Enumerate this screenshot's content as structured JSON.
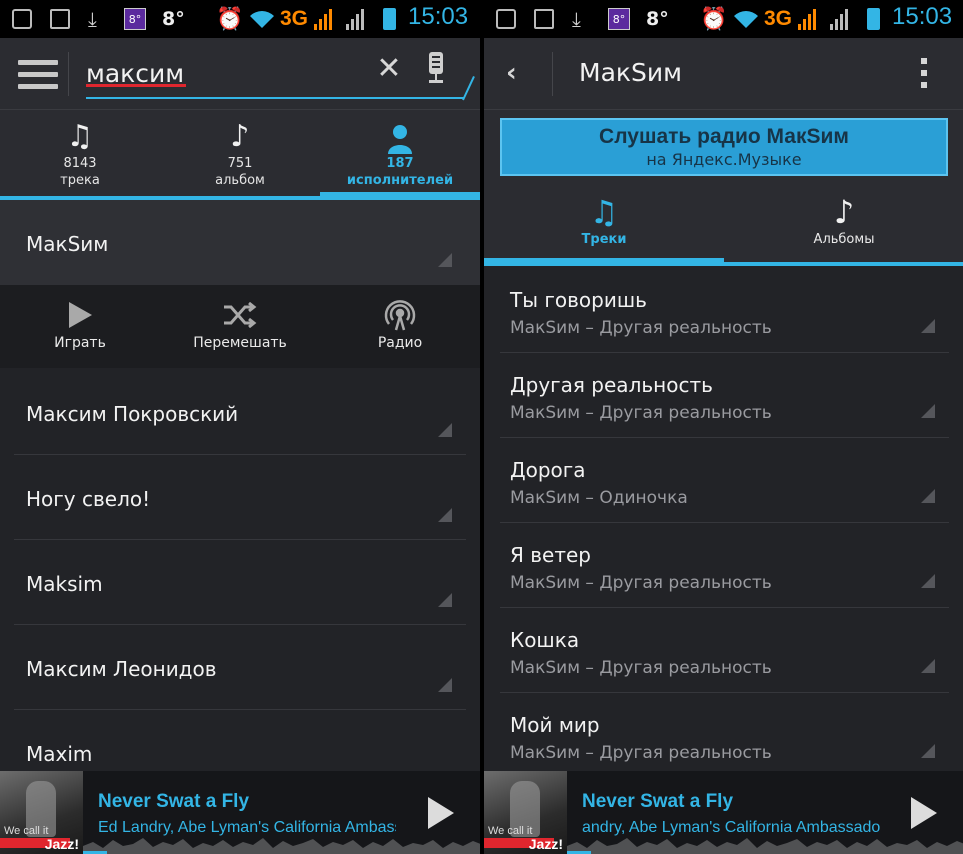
{
  "status_bar": {
    "temperature": "8°",
    "weather_badge": "8°",
    "network": "3G",
    "time": "15:03"
  },
  "left": {
    "search": {
      "value": "максим"
    },
    "tabs": [
      {
        "icon": "music-notes-icon",
        "count": "8143",
        "label": "трека"
      },
      {
        "icon": "music-note-icon",
        "count": "751",
        "label": "альбом"
      },
      {
        "icon": "person-icon",
        "count": "187",
        "label": "исполнителей",
        "active": true
      }
    ],
    "expanded_artist": "МакSим",
    "actions": [
      {
        "icon": "play-icon",
        "label": "Играть"
      },
      {
        "icon": "shuffle-icon",
        "label": "Перемешать"
      },
      {
        "icon": "radio-icon",
        "label": "Радио"
      }
    ],
    "results": [
      "Максим Покровский",
      "Ногу свело!",
      "Maksim",
      "Максим Леонидов",
      "Maxim"
    ]
  },
  "right": {
    "title": "МакSим",
    "banner": {
      "title": "Слушать радио МакSим",
      "subtitle": "на Яндекс.Музыке"
    },
    "tabs": [
      {
        "icon": "music-notes-icon",
        "label": "Треки",
        "active": true
      },
      {
        "icon": "music-note-icon",
        "label": "Альбомы"
      }
    ],
    "tracks": [
      {
        "title": "Ты говоришь",
        "subtitle": "МакSим – Другая реальность"
      },
      {
        "title": "Другая реальность",
        "subtitle": "МакSим – Другая реальность"
      },
      {
        "title": "Дорога",
        "subtitle": "МакSим – Одиночка"
      },
      {
        "title": "Я ветер",
        "subtitle": "МакSим – Другая реальность"
      },
      {
        "title": "Кошка",
        "subtitle": "МакSим – Другая реальность"
      },
      {
        "title": "Мой мир",
        "subtitle": "МакSим – Другая реальность"
      }
    ]
  },
  "now_playing": {
    "left": {
      "title": "Never Swat a Fly",
      "artist": "Ed Landry, Abe Lyman's California Ambassador",
      "art_caption": "We call it",
      "art_word": "Jazz!",
      "progress": 0.05
    },
    "right": {
      "title": "Never Swat a Fly",
      "artist": "andry, Abe Lyman's California Ambassador",
      "art_caption": "We call it",
      "art_word": "Jazz!",
      "progress": 0.05
    }
  },
  "colors": {
    "accent": "#33b5e5",
    "background": "#222327",
    "bar": "#2b2c31",
    "network": "#ff8a00",
    "spell_underline": "#e0262e"
  }
}
